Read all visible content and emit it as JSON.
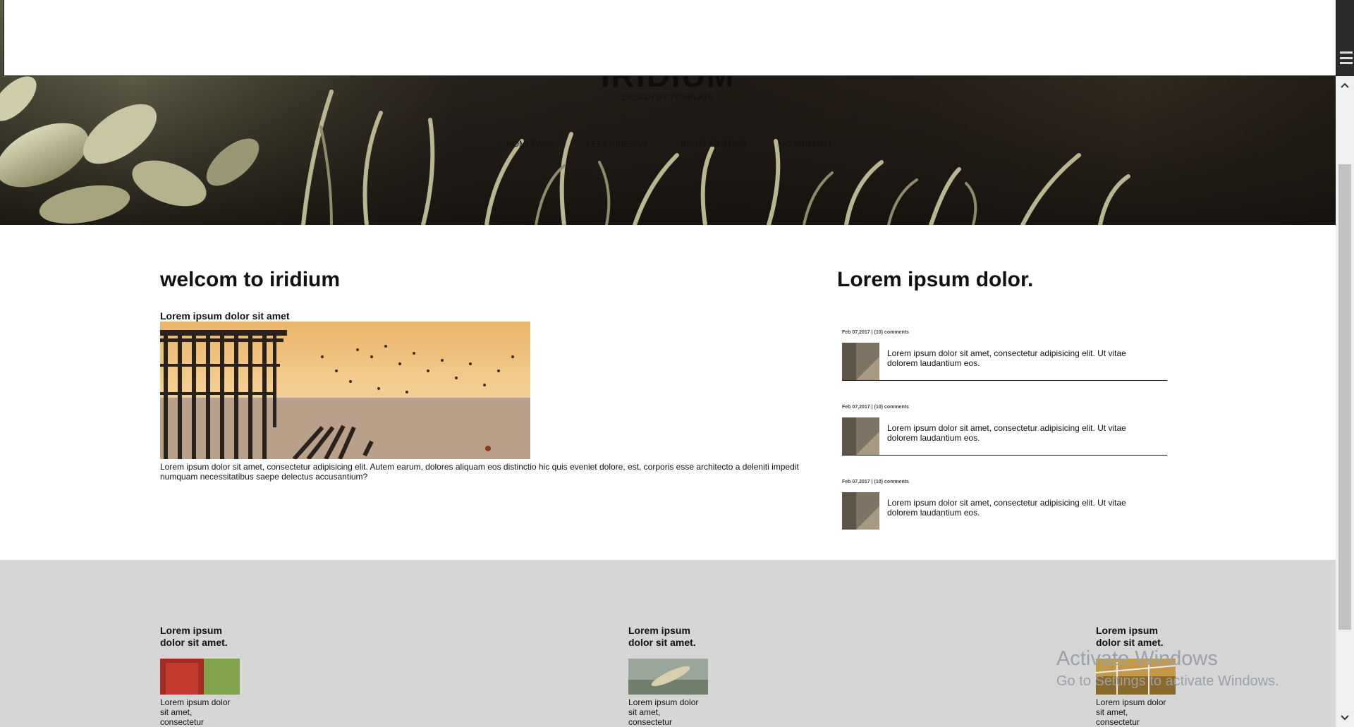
{
  "site": {
    "title": "IRIDIUM",
    "subtitle": "DESIGN BY TEMPLATE"
  },
  "nav": {
    "items": [
      {
        "label": "HOMEPAGE"
      },
      {
        "label": "LEFT SIDEBAR"
      },
      {
        "label": "RIGHT SIDEBAR"
      },
      {
        "label": "NO SIDEBAR"
      }
    ]
  },
  "main": {
    "heading": "welcom to iridium",
    "subheading": "Lorem ipsum dolor sit amet",
    "body": "Lorem ipsum dolor sit amet, consectetur adipisicing elit. Autem earum, dolores aliquam eos distinctio hic quis eveniet dolore, est, corporis esse architecto a deleniti impedit numquam necessitatibus saepe delectus accusantium?"
  },
  "sidebar": {
    "heading": "Lorem ipsum dolor.",
    "posts": [
      {
        "meta": "Feb 07,2017 | (10) comments",
        "text": "Lorem ipsum dolor sit amet, consectetur adipisicing elit. Ut vitae dolorem laudantium eos."
      },
      {
        "meta": "Feb 07,2017 | (10) comments",
        "text": "Lorem ipsum dolor sit amet, consectetur adipisicing elit. Ut vitae dolorem laudantium eos."
      },
      {
        "meta": "Feb 07,2017 | (10) comments",
        "text": "Lorem ipsum dolor sit amet, consectetur adipisicing elit. Ut vitae dolorem laudantium eos."
      }
    ]
  },
  "footer": {
    "columns": [
      {
        "heading_line1": "Lorem ipsum",
        "heading_line2": "dolor sit amet.",
        "text_line1": "Lorem ipsum dolor",
        "text_line2": "sit amet,",
        "text_line3": "consectetur"
      },
      {
        "heading_line1": "Lorem ipsum",
        "heading_line2": "dolor sit amet.",
        "text_line1": "Lorem ipsum dolor",
        "text_line2": "sit amet,",
        "text_line3": "consectetur"
      },
      {
        "heading_line1": "Lorem ipsum",
        "heading_line2": "dolor sit amet.",
        "text_line1": "Lorem ipsum dolor",
        "text_line2": "sit amet,",
        "text_line3": "consectetur"
      }
    ]
  },
  "watermark": {
    "line1": "Activate Windows",
    "line2": "Go to Settings to activate Windows."
  },
  "icons": {
    "menu": "hamburger-menu-icon",
    "scroll_up": "chevron-up-icon",
    "scroll_down": "chevron-down-icon"
  }
}
